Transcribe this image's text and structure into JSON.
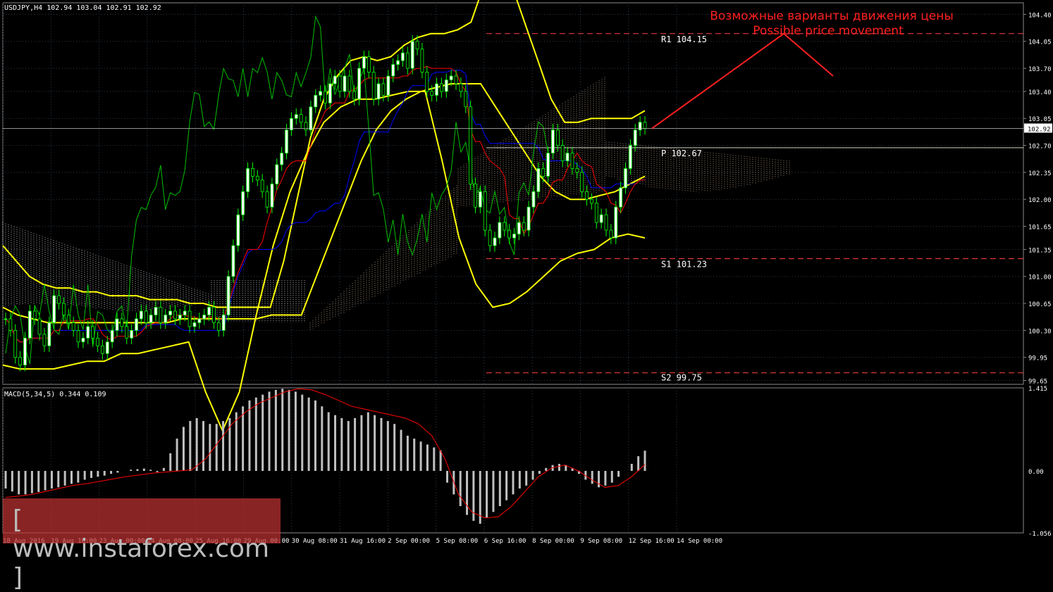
{
  "window": {
    "symbol_label": "USDJPY,H4  102.94 103.04 102.91 102.92"
  },
  "annotation": {
    "line1": "Возможные варианты движения цены",
    "line2": "Possible price movement",
    "color": "#ff2020"
  },
  "watermark": {
    "text": "[ www.instaforex.com ]"
  },
  "colors": {
    "background": "#000000",
    "grid": "#2a3a4a",
    "bull_candle": "#ffffff",
    "bear_candle": "#000000",
    "candle_wick": "#00ff00",
    "bollinger": "#ffff00",
    "tenkan": "#ff0000",
    "kijun": "#0000ff",
    "chikou": "#00c000",
    "cloud_up": "#e0c0a0",
    "cloud_down": "#ffffff",
    "macd_hist": "#c0c0c0",
    "macd_signal": "#ff0000",
    "pivot_line": "#ff4040",
    "price_line": "#c0c0c0"
  },
  "chart_data": [
    {
      "type": "candlestick",
      "symbol": "USDJPY",
      "timeframe": "H4",
      "ohlc_header": {
        "open": 102.94,
        "high": 103.04,
        "low": 102.91,
        "close": 102.92
      },
      "current_price": 102.92,
      "current_price_label": "102.92",
      "ylim": [
        99.6,
        104.55
      ],
      "y_ticks": [
        "104.40",
        "104.05",
        "103.70",
        "103.40",
        "103.05",
        "102.70",
        "102.35",
        "102.00",
        "101.65",
        "101.35",
        "101.00",
        "100.65",
        "100.30",
        "99.95",
        "99.65"
      ],
      "y_tick_values": [
        104.4,
        104.05,
        103.7,
        103.4,
        103.05,
        102.7,
        102.35,
        102.0,
        101.65,
        101.35,
        101.0,
        100.65,
        100.3,
        99.95,
        99.65
      ],
      "x_ticks": [
        "18 Aug 2016",
        "19 Aug 16:00",
        "23 Aug 00:00",
        "24 Aug 08:00",
        "25 Aug 16:00",
        "29 Aug 00:00",
        "30 Aug 08:00",
        "31 Aug 16:00",
        "2 Sep 00:00",
        "5 Sep 08:00",
        "6 Sep 16:00",
        "8 Sep 00:00",
        "9 Sep 08:00",
        "12 Sep 16:00",
        "14 Sep 00:00"
      ],
      "levels": [
        {
          "label": "R1 104.15",
          "value": 104.15
        },
        {
          "label": "P 102.67",
          "value": 102.67
        },
        {
          "label": "S1 101.23",
          "value": 101.23
        },
        {
          "label": "S2 99.75",
          "value": 99.75
        }
      ],
      "close_series": [
        100.45,
        100.3,
        99.95,
        99.85,
        100.2,
        100.55,
        100.45,
        100.25,
        100.1,
        100.4,
        100.75,
        100.65,
        100.5,
        100.4,
        100.3,
        100.15,
        100.2,
        100.35,
        100.2,
        100.1,
        100.0,
        100.15,
        100.3,
        100.45,
        100.35,
        100.2,
        100.3,
        100.45,
        100.55,
        100.4,
        100.5,
        100.6,
        100.4,
        100.5,
        100.55,
        100.45,
        100.5,
        100.55,
        100.35,
        100.4,
        100.45,
        100.5,
        100.6,
        100.4,
        100.3,
        100.5,
        101.0,
        101.4,
        101.8,
        102.1,
        102.4,
        102.3,
        102.25,
        102.1,
        101.9,
        102.2,
        102.45,
        102.6,
        102.9,
        103.05,
        103.1,
        103.0,
        102.9,
        103.2,
        103.35,
        103.4,
        103.25,
        103.5,
        103.6,
        103.4,
        103.6,
        103.4,
        103.3,
        103.7,
        103.85,
        103.65,
        103.3,
        103.5,
        103.35,
        103.6,
        103.75,
        103.8,
        103.9,
        103.7,
        104.05,
        103.95,
        103.65,
        103.4,
        103.35,
        103.5,
        103.4,
        103.55,
        103.6,
        103.5,
        103.4,
        103.2,
        102.2,
        101.9,
        102.1,
        101.6,
        101.4,
        101.5,
        101.7,
        101.6,
        101.5,
        101.55,
        101.7,
        101.6,
        101.9,
        102.1,
        102.4,
        102.3,
        102.6,
        102.9,
        102.7,
        102.5,
        102.6,
        102.4,
        102.35,
        102.1,
        102.0,
        101.95,
        101.7,
        101.8,
        101.6,
        101.5,
        101.9,
        102.15,
        102.4,
        102.7,
        102.9,
        103.0,
        102.92
      ],
      "bollinger_upper": [
        101.4,
        101.2,
        101.0,
        100.9,
        100.85,
        100.85,
        100.8,
        100.8,
        100.75,
        100.75,
        100.75,
        100.7,
        100.7,
        100.7,
        100.65,
        100.65,
        100.6,
        100.6,
        100.6,
        100.6,
        100.6,
        101.2,
        102.0,
        102.8,
        103.3,
        103.6,
        103.8,
        103.85,
        103.8,
        103.85,
        104.0,
        104.1,
        104.15,
        104.15,
        104.2,
        104.3,
        104.8,
        105.0,
        104.8,
        104.3,
        103.8,
        103.3,
        103.0,
        103.0,
        103.05,
        103.05,
        103.05,
        103.05,
        103.15
      ],
      "bollinger_middle": [
        100.6,
        100.5,
        100.45,
        100.4,
        100.4,
        100.4,
        100.4,
        100.4,
        100.4,
        100.4,
        100.4,
        100.4,
        100.45,
        100.45,
        100.45,
        100.45,
        100.45,
        100.45,
        100.5,
        100.5,
        100.5,
        101.0,
        101.5,
        102.0,
        102.5,
        102.9,
        103.15,
        103.3,
        103.4,
        103.45,
        103.5,
        103.5,
        103.5,
        103.2,
        102.9,
        102.6,
        102.3,
        102.1,
        102.0,
        102.0,
        102.05,
        102.1,
        102.2,
        102.3
      ],
      "bollinger_lower": [
        99.85,
        99.8,
        99.8,
        99.8,
        99.85,
        99.9,
        99.9,
        100.0,
        100.0,
        100.05,
        100.1,
        100.15,
        99.5,
        99.0,
        99.5,
        100.5,
        101.4,
        102.1,
        102.6,
        103.0,
        103.2,
        103.3,
        103.3,
        103.35,
        103.4,
        103.4,
        102.5,
        101.5,
        100.9,
        100.6,
        100.65,
        100.8,
        101.0,
        101.2,
        101.3,
        101.35,
        101.5,
        101.55,
        101.5
      ]
    },
    {
      "type": "bar",
      "title": "MACD(5,34,5) 0.344 0.109",
      "ylim": [
        -1.056,
        1.415
      ],
      "y_ticks": [
        "1.415",
        "0.00",
        "-1.056"
      ],
      "y_tick_values": [
        1.415,
        0.0,
        -1.056
      ],
      "histogram": [
        -0.3,
        -0.35,
        -0.4,
        -0.4,
        -0.38,
        -0.36,
        -0.33,
        -0.3,
        -0.28,
        -0.25,
        -0.22,
        -0.2,
        -0.15,
        -0.12,
        -0.1,
        -0.08,
        -0.05,
        -0.03,
        0.0,
        0.02,
        0.03,
        0.04,
        0.02,
        -0.02,
        0.05,
        0.3,
        0.55,
        0.75,
        0.85,
        0.9,
        0.85,
        0.8,
        0.8,
        0.85,
        0.9,
        1.0,
        1.1,
        1.2,
        1.25,
        1.3,
        1.35,
        1.38,
        1.4,
        1.38,
        1.35,
        1.3,
        1.25,
        1.2,
        1.1,
        1.0,
        0.95,
        0.9,
        0.85,
        0.9,
        0.95,
        1.0,
        0.95,
        0.9,
        0.85,
        0.8,
        0.7,
        0.6,
        0.55,
        0.5,
        0.45,
        0.4,
        0.35,
        -0.2,
        -0.4,
        -0.6,
        -0.75,
        -0.85,
        -0.9,
        -0.8,
        -0.7,
        -0.6,
        -0.5,
        -0.4,
        -0.3,
        -0.25,
        -0.15,
        -0.05,
        0.05,
        0.1,
        0.12,
        0.1,
        0.05,
        -0.05,
        -0.15,
        -0.22,
        -0.28,
        -0.25,
        -0.2,
        -0.1,
        0.0,
        0.12,
        0.25,
        0.344
      ],
      "signal": [
        -0.45,
        -0.43,
        -0.4,
        -0.35,
        -0.3,
        -0.25,
        -0.22,
        -0.18,
        -0.14,
        -0.1,
        -0.07,
        -0.04,
        -0.02,
        0.0,
        0.02,
        0.2,
        0.5,
        0.8,
        1.0,
        1.15,
        1.25,
        1.35,
        1.4,
        1.38,
        1.3,
        1.2,
        1.1,
        1.05,
        1.0,
        0.95,
        0.9,
        0.8,
        0.6,
        0.2,
        -0.4,
        -0.7,
        -0.8,
        -0.78,
        -0.6,
        -0.35,
        -0.1,
        0.05,
        0.1,
        0.0,
        -0.15,
        -0.28,
        -0.25,
        -0.1,
        0.109
      ]
    }
  ]
}
